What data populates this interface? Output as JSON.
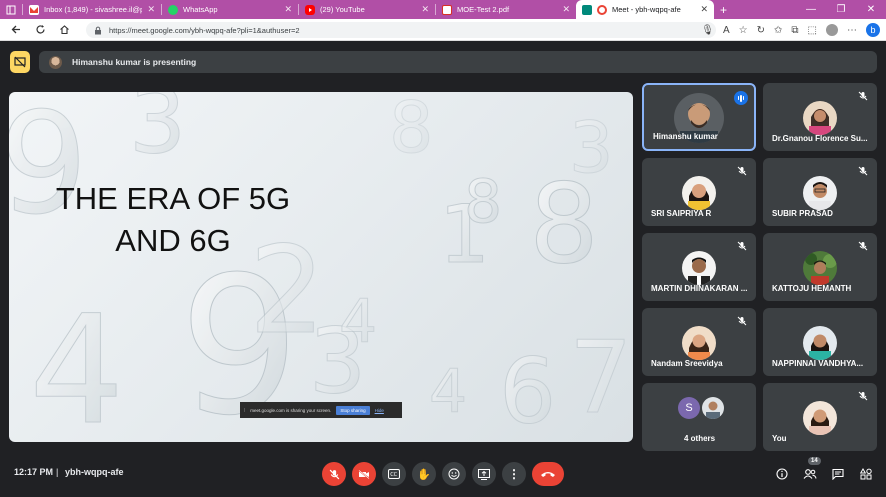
{
  "browser": {
    "tabs": [
      {
        "title": "Inbox (1,849) - sivashree.il@pec.e",
        "icon": "gmail-icon",
        "color": "#ea4335"
      },
      {
        "title": "WhatsApp",
        "icon": "whatsapp-icon",
        "color": "#25d366"
      },
      {
        "title": "(29) YouTube",
        "icon": "youtube-icon",
        "color": "#ff0000"
      },
      {
        "title": "MOE-Test 2.pdf",
        "icon": "pdf-icon",
        "color": "#d93025"
      },
      {
        "title": "Meet - ybh-wqpq-afe",
        "icon": "meet-icon",
        "color": "#00897b",
        "active": true
      }
    ],
    "url": "https://meet.google.com/ybh-wqpq-afe?pli=1&authuser=2",
    "accent": "#b14fa6"
  },
  "banner": {
    "presenting_text": "Himanshu kumar is presenting"
  },
  "slide": {
    "title": "THE ERA OF 5G\nAND 6G"
  },
  "share_bar": {
    "text": "meet.google.com is sharing your screen.",
    "stop_label": "Stop sharing",
    "hide_label": "Hide"
  },
  "participants": [
    {
      "name": "Himanshu kumar",
      "speaking": true,
      "muted": false
    },
    {
      "name": "Dr.Gnanou Florence Su...",
      "muted": true
    },
    {
      "name": "SRI SAIPRIYA R",
      "muted": true
    },
    {
      "name": "SUBIR PRASAD",
      "muted": true
    },
    {
      "name": "MARTIN DHINAKARAN ...",
      "muted": true
    },
    {
      "name": "KATTOJU HEMANTH",
      "muted": true
    },
    {
      "name": "Nandam Sreevidya",
      "muted": true
    },
    {
      "name": "NAPPINNAI VANDHYA...",
      "muted": true
    },
    {
      "name": "4 others",
      "initial": "S"
    },
    {
      "name": "You",
      "muted": true
    }
  ],
  "controls": {
    "time": "12:17 PM",
    "separator": "|",
    "meeting_code": "ybh-wqpq-afe",
    "people_count": "14"
  }
}
